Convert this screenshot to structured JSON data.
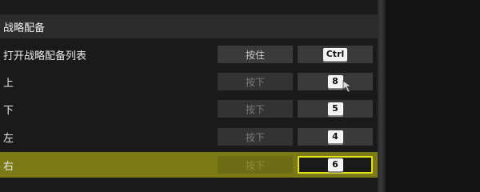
{
  "section_title": "战略配备",
  "rows": [
    {
      "label": "打开战略配备列表",
      "mode": "按住",
      "key": "Ctrl"
    },
    {
      "label": "上",
      "mode": "按下",
      "key": "8"
    },
    {
      "label": "下",
      "mode": "按下",
      "key": "5"
    },
    {
      "label": "左",
      "mode": "按下",
      "key": "4"
    },
    {
      "label": "右",
      "mode": "按下",
      "key": "6"
    }
  ],
  "selected_row": 4,
  "colors": {
    "highlight": "#7c7a16",
    "focus_border": "#e6e21a"
  },
  "icons": {
    "cursor": "pointer-cursor-icon"
  }
}
